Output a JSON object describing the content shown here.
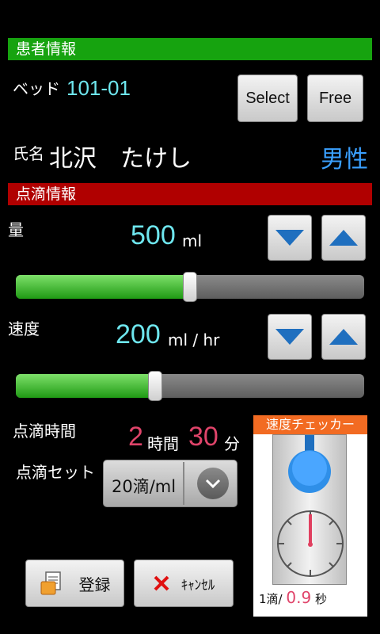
{
  "patient": {
    "section_title": "患者情報",
    "bed_label": "ベッド",
    "bed_value": "101-01",
    "select_label": "Select",
    "free_label": "Free",
    "name_label": "氏名",
    "name_value": "北沢　たけし",
    "gender": "男性"
  },
  "drip": {
    "section_title": "点滴情報",
    "volume_label": "量",
    "volume_value": "500",
    "volume_unit": "ml",
    "volume_fraction": 0.5,
    "speed_label": "速度",
    "speed_value": "200",
    "speed_unit": "ml / hr",
    "speed_fraction": 0.4,
    "time_label": "点滴時間",
    "hours": "2",
    "hours_unit": "時間",
    "minutes": "30",
    "minutes_unit": "分",
    "set_label": "点滴セット",
    "set_value": "20滴/ml"
  },
  "checker": {
    "title": "速度チェッカー",
    "drop_prefix": "1滴/",
    "drop_seconds": "0.9",
    "drop_unit": "秒"
  },
  "actions": {
    "register_label": "登録",
    "cancel_label": "ｷｬﾝｾﾙ"
  },
  "colors": {
    "patient_bar": "#16a30f",
    "drip_bar": "#b00000",
    "checker_title": "#f26b22",
    "accent_cyan": "#6ee6ee",
    "accent_red": "#e0446a",
    "gender_blue": "#3aa0ff"
  }
}
